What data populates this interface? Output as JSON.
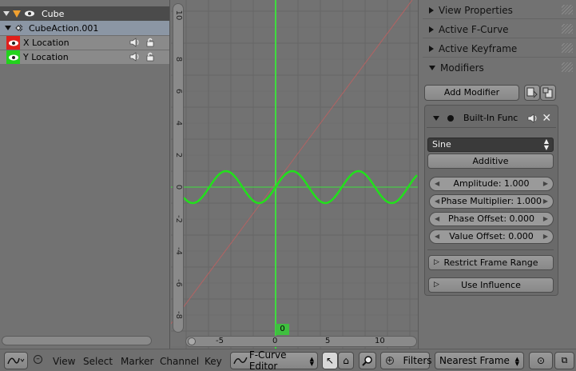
{
  "channels": {
    "object": {
      "label": "Cube"
    },
    "action": {
      "label": "CubeAction.001"
    },
    "fcurves": [
      {
        "label": "X Location",
        "color": "#e0201b"
      },
      {
        "label": "Y Location",
        "color": "#22d21c"
      }
    ]
  },
  "graph": {
    "y_ticks": [
      "10",
      "8",
      "6",
      "4",
      "2",
      "0",
      "-2",
      "-4",
      "-6",
      "-8"
    ],
    "x_ticks": [
      "-5",
      "0",
      "5",
      "10"
    ],
    "current_frame": "0",
    "colors": {
      "active_curve": "#22e01c",
      "x_curve": "#b26363",
      "playhead": "#3fdd3f"
    }
  },
  "properties": {
    "panels": [
      {
        "label": "View Properties"
      },
      {
        "label": "Active F-Curve"
      },
      {
        "label": "Active Keyframe"
      },
      {
        "label": "Modifiers"
      }
    ],
    "add_modifier": "Add Modifier",
    "modifier": {
      "name": "Built-In Func",
      "function": "Sine",
      "additive": "Additive",
      "fields": [
        {
          "label": "Amplitude: 1.000"
        },
        {
          "label": "Phase Multiplier: 1.000"
        },
        {
          "label": "Phase Offset: 0.000"
        },
        {
          "label": "Value Offset: 0.000"
        }
      ],
      "restrict_frame_range": "Restrict Frame Range",
      "use_influence": "Use Influence"
    }
  },
  "footer": {
    "menus": [
      "View",
      "Select",
      "Marker",
      "Channel",
      "Key"
    ],
    "mode": "F-Curve Editor",
    "filters": "Filters",
    "snap": "Nearest Frame"
  }
}
